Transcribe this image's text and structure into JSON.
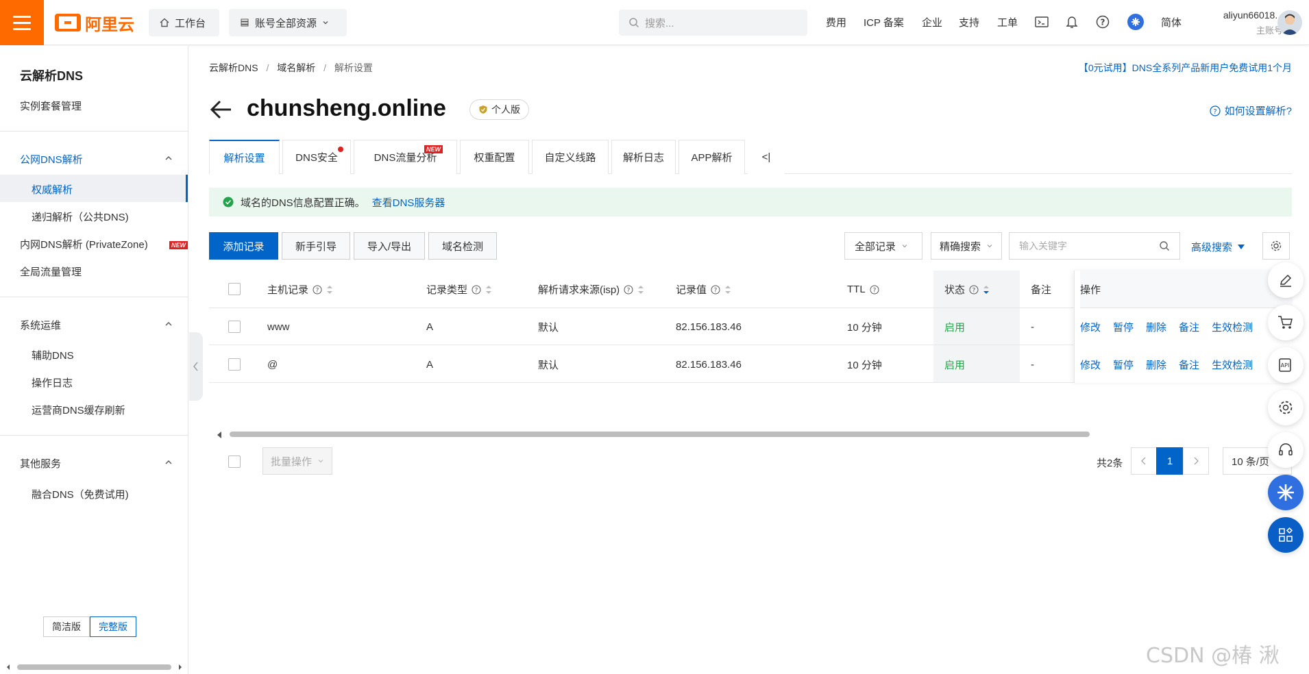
{
  "topbar": {
    "logo_text": "阿里云",
    "workbench": "工作台",
    "resources": "账号全部资源",
    "search_placeholder": "搜索...",
    "links": [
      "费用",
      "ICP 备案",
      "企业",
      "支持",
      "工单"
    ],
    "lang": "简体",
    "username": "aliyun66018...",
    "account_type": "主账号"
  },
  "sidebar": {
    "title": "云解析DNS",
    "instance": "实例套餐管理",
    "public_dns": "公网DNS解析",
    "authoritative": "权威解析",
    "recursive": "递归解析（公共DNS)",
    "private_zone": "内网DNS解析 (PrivateZone)",
    "private_zone_badge": "NEW",
    "gtm": "全局流量管理",
    "ops": "系统运维",
    "aux_dns": "辅助DNS",
    "op_log": "操作日志",
    "cache_refresh": "运营商DNS缓存刷新",
    "other": "其他服务",
    "fusion_dns": "融合DNS（免费试用)",
    "mode_simple": "简洁版",
    "mode_full": "完整版"
  },
  "breadcrumb": [
    "云解析DNS",
    "域名解析",
    "解析设置"
  ],
  "promo": "【0元试用】DNS全系列产品新用户免费试用1个月",
  "domain": "chunsheng.online",
  "edition": "个人版",
  "help_link": "如何设置解析?",
  "tabs": [
    "解析设置",
    "DNS安全",
    "DNS流量分析",
    "权重配置",
    "自定义线路",
    "解析日志",
    "APP解析"
  ],
  "tab_new_badge": "NEW",
  "tab_collapse": "<|",
  "alert": {
    "text": "域名的DNS信息配置正确。",
    "link": "查看DNS服务器"
  },
  "toolbar": {
    "add": "添加记录",
    "guide": "新手引导",
    "import_export": "导入/导出",
    "check": "域名检测",
    "filter": "全部记录",
    "search_mode": "精确搜索",
    "keyword_placeholder": "输入关键字",
    "advanced": "高级搜索"
  },
  "table": {
    "headers": [
      "主机记录",
      "记录类型",
      "解析请求来源(isp)",
      "记录值",
      "TTL",
      "状态",
      "备注",
      "操作"
    ],
    "rows": [
      {
        "host": "www",
        "type": "A",
        "isp": "默认",
        "value": "82.156.183.46",
        "ttl": "10 分钟",
        "status": "启用",
        "note": "-"
      },
      {
        "host": "@",
        "type": "A",
        "isp": "默认",
        "value": "82.156.183.46",
        "ttl": "10 分钟",
        "status": "启用",
        "note": "-"
      }
    ],
    "actions": [
      "修改",
      "暂停",
      "删除",
      "备注",
      "生效检测"
    ]
  },
  "footer": {
    "bulk": "批量操作",
    "total": "共2条",
    "page": "1",
    "page_size": "10 条/页"
  },
  "watermark": "CSDN @椿  湫"
}
